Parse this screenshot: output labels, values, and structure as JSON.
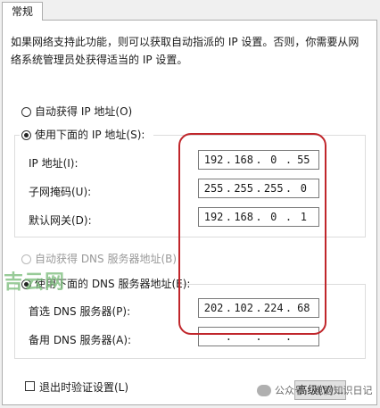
{
  "tab": {
    "label": "常规"
  },
  "description": "如果网络支持此功能，则可以获取自动指派的 IP 设置。否则，你需要从网络系统管理员处获得适当的 IP 设置。",
  "ip": {
    "auto_label": "自动获得 IP 地址(O)",
    "manual_label": "使用下面的 IP 地址(S):",
    "address_label": "IP 地址(I):",
    "address": [
      "192",
      "168",
      "0",
      "55"
    ],
    "mask_label": "子网掩码(U):",
    "mask": [
      "255",
      "255",
      "255",
      "0"
    ],
    "gateway_label": "默认网关(D):",
    "gateway": [
      "192",
      "168",
      "0",
      "1"
    ]
  },
  "dns": {
    "auto_label": "自动获得 DNS 服务器地址(B)",
    "manual_label": "使用下面的 DNS 服务器地址(E):",
    "preferred_label": "首选 DNS 服务器(P):",
    "preferred": [
      "202",
      "102",
      "224",
      "68"
    ],
    "alternate_label": "备用 DNS 服务器(A):",
    "alternate": [
      "",
      "",
      "",
      ""
    ]
  },
  "validate_label": "退出时验证设置(L)",
  "advanced_label": "高级(V)...",
  "watermark": "吉云网",
  "credit": "公众号 · 电脑知识日记",
  "colors": {
    "annotation": "#c0262b",
    "watermark": "#7fbf7f"
  }
}
